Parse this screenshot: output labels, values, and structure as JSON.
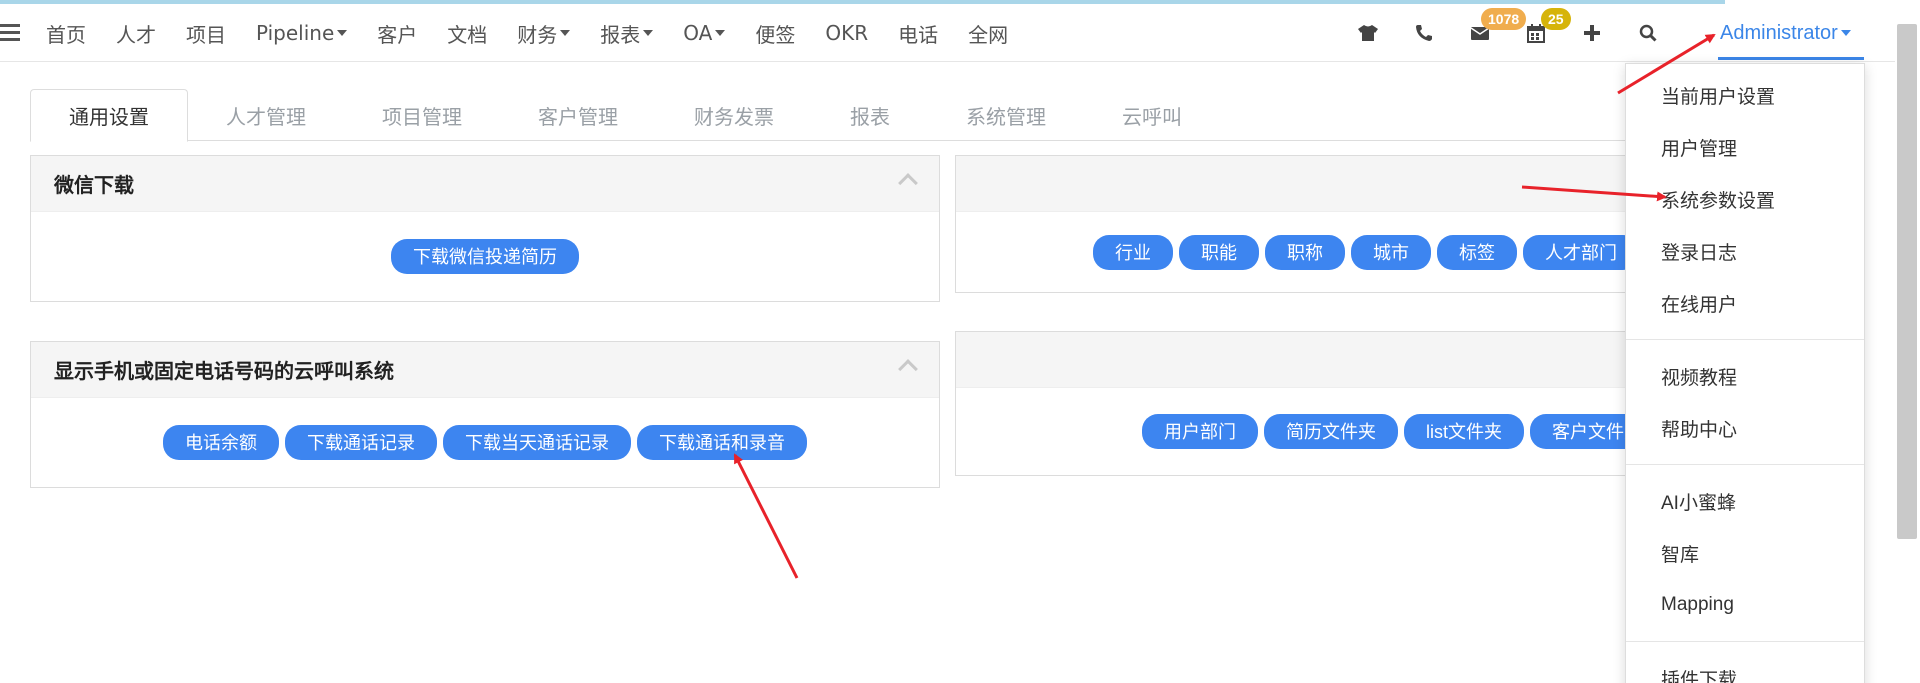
{
  "nav": {
    "items": [
      {
        "label": "首页",
        "dropdown": false
      },
      {
        "label": "人才",
        "dropdown": false
      },
      {
        "label": "项目",
        "dropdown": false
      },
      {
        "label": "Pipeline",
        "dropdown": true
      },
      {
        "label": "客户",
        "dropdown": false
      },
      {
        "label": "文档",
        "dropdown": false
      },
      {
        "label": "财务",
        "dropdown": true
      },
      {
        "label": "报表",
        "dropdown": true
      },
      {
        "label": "OA",
        "dropdown": true
      },
      {
        "label": "便签",
        "dropdown": false
      },
      {
        "label": "OKR",
        "dropdown": false
      },
      {
        "label": "电话",
        "dropdown": false
      },
      {
        "label": "全网",
        "dropdown": false
      }
    ],
    "mail_badge": "1078",
    "calendar_badge": "25",
    "user": "Administrator"
  },
  "tabs": [
    "通用设置",
    "人才管理",
    "项目管理",
    "客户管理",
    "财务发票",
    "报表",
    "系统管理",
    "云呼叫"
  ],
  "panels": {
    "wechat": {
      "title": "微信下载",
      "buttons": [
        "下载微信投递简历"
      ]
    },
    "cloud_call": {
      "title": "显示手机或固定电话号码的云呼叫系统",
      "buttons": [
        "电话余额",
        "下载通话记录",
        "下载当天通话记录",
        "下载通话和录音"
      ]
    },
    "right_top": {
      "buttons": [
        "行业",
        "职能",
        "职称",
        "城市",
        "标签",
        "人才部门"
      ]
    },
    "right_bottom": {
      "buttons": [
        "用户部门",
        "简历文件夹",
        "list文件夹",
        "客户文件夹"
      ]
    }
  },
  "dropdown": {
    "group1": [
      "当前用户设置",
      "用户管理",
      "系统参数设置",
      "登录日志",
      "在线用户"
    ],
    "group2": [
      "视频教程",
      "帮助中心"
    ],
    "group3": [
      "AI小蜜蜂",
      "智库",
      "Mapping"
    ],
    "group4": [
      "插件下载"
    ]
  },
  "colors": {
    "accent": "#3b86e8",
    "button": "#3d85f0",
    "arrow": "#e8222a",
    "badge_orange": "#f0ad4e",
    "badge_yellow": "#d6b40a"
  }
}
